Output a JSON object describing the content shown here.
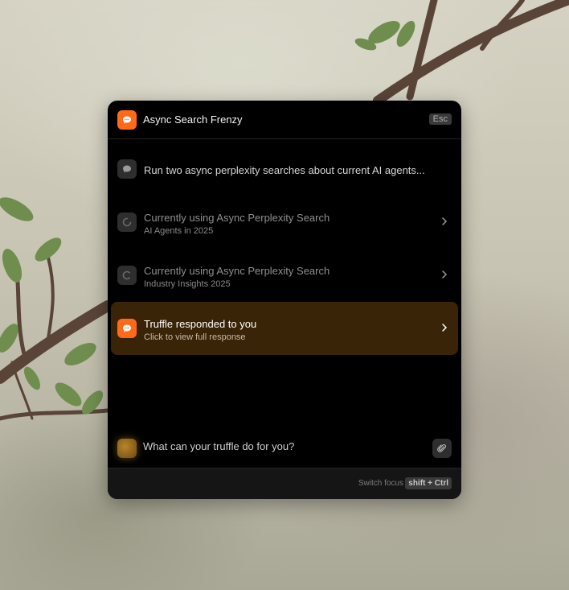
{
  "header": {
    "title": "Async Search Frenzy",
    "esc_label": "Esc",
    "icon": "chat-bubble-icon"
  },
  "conversation": {
    "user_message": "Run two async perplexity searches about current AI agents...",
    "tasks": [
      {
        "title": "Currently using Async Perplexity Search",
        "subtitle": "AI Agents in 2025",
        "status_icon": "spinner-icon"
      },
      {
        "title": "Currently using Async Perplexity Search",
        "subtitle": "Industry Insights 2025",
        "status_icon": "spinner-icon"
      }
    ],
    "response": {
      "title": "Truffle responded to you",
      "subtitle": "Click to view full response",
      "icon": "chat-bubble-icon"
    }
  },
  "input": {
    "placeholder": "What can your truffle do for you?",
    "attach_icon": "paperclip-icon"
  },
  "footer": {
    "label": "Switch focus",
    "shortcut": "shift + Ctrl"
  },
  "colors": {
    "accent": "#ff6a1a",
    "highlight_bg": "#3a2408",
    "panel_bg": "#000000"
  }
}
